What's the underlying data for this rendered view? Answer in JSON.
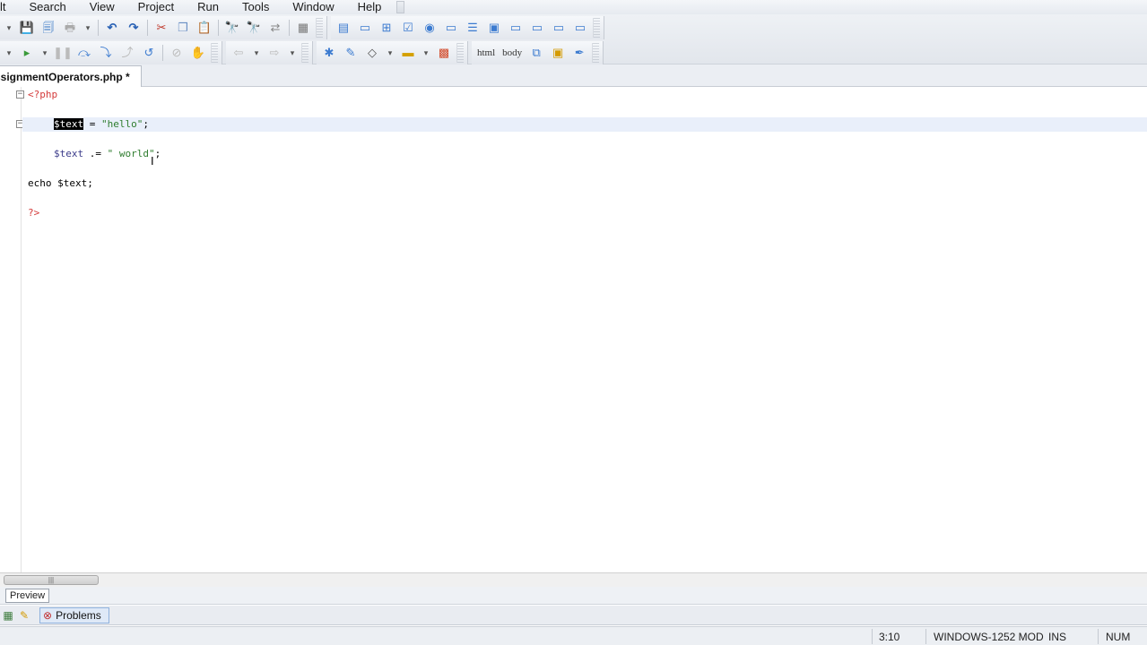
{
  "menu": {
    "items": [
      {
        "label": "lt"
      },
      {
        "label": "Search"
      },
      {
        "label": "View"
      },
      {
        "label": "Project"
      },
      {
        "label": "Run"
      },
      {
        "label": "Tools"
      },
      {
        "label": "Window"
      },
      {
        "label": "Help"
      }
    ]
  },
  "toolbar": {
    "html_label": "html",
    "body_label": "body"
  },
  "editor": {
    "tab_title": "ssignmentOperators.php *",
    "lines": {
      "l1": "<?php",
      "l2_var": "$text",
      "l2_rest_op": " = ",
      "l2_str": "\"hello\"",
      "l2_end": ";",
      "l3_var": "$text",
      "l3_op": " .= ",
      "l3_str": "\" world\"",
      "l3_end": ";",
      "l4": "echo $text;",
      "l5": "?>"
    }
  },
  "lower": {
    "preview_tab": "Preview",
    "problems_tab": "Problems"
  },
  "status": {
    "position": "3:10",
    "encoding": "WINDOWS-1252 MOD",
    "mode": "INS",
    "num": "NUM"
  }
}
